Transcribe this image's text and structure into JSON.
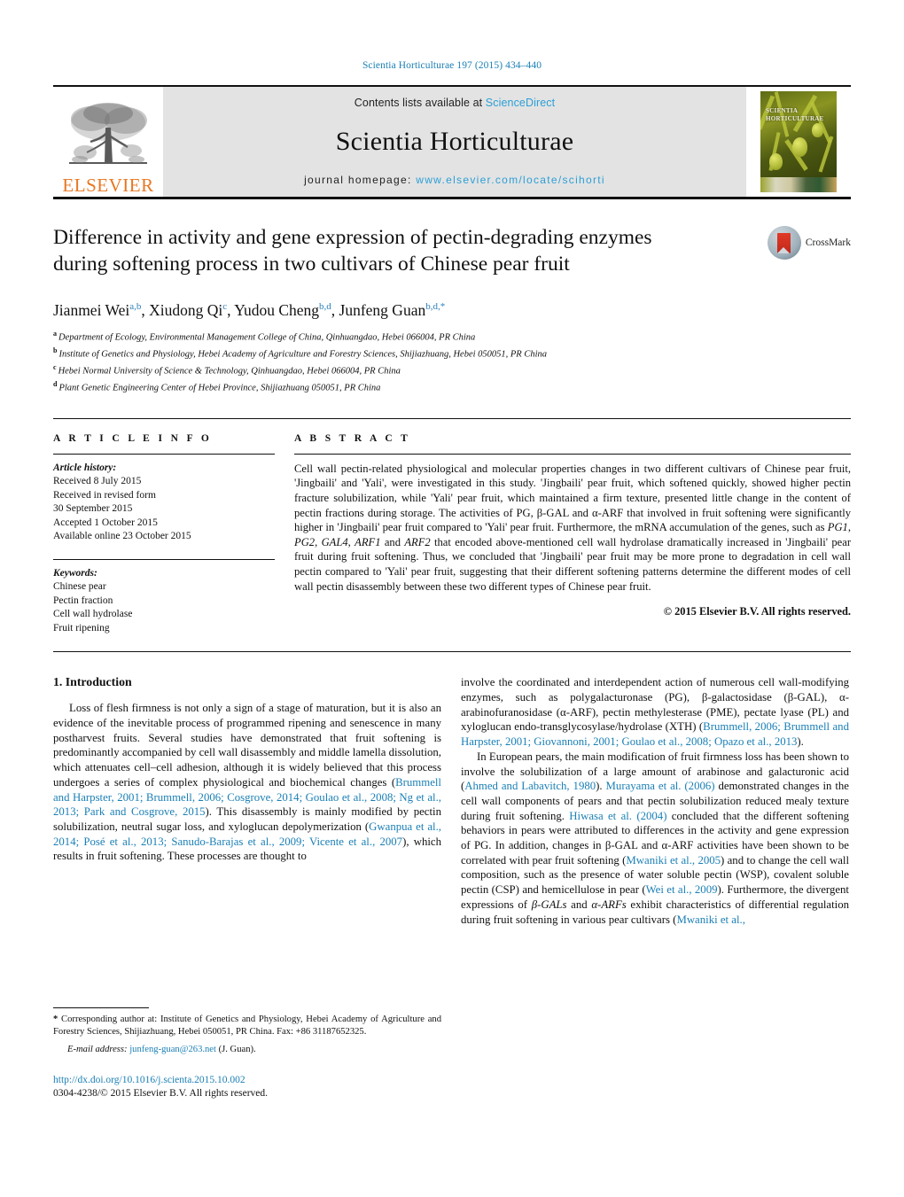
{
  "running_head": "Scientia Horticulturae 197 (2015) 434–440",
  "masthead": {
    "contents_prefix": "Contents lists available at ",
    "sciencedirect": "ScienceDirect",
    "journal_title": "Scientia Horticulturae",
    "homepage_prefix": "journal homepage: ",
    "homepage_url": "www.elsevier.com/locate/scihorti",
    "publisher": "ELSEVIER",
    "cover_title_line1": "SCIENTIA",
    "cover_title_line2": "HORTICULTURAE",
    "link_color": "#2c9fd6",
    "publisher_color": "#E87722"
  },
  "article": {
    "title": "Difference in activity and gene expression of pectin-degrading enzymes during softening process in two cultivars of Chinese pear fruit",
    "crossmark_label": "CrossMark",
    "authors_html": "Jianmei Wei<sup>a,b</sup>, Xiudong Qi<sup>c</sup>, Yudou Cheng<sup>b,d</sup>, Junfeng Guan<sup>b,d,</sup><sup>*</sup>",
    "affiliations": [
      {
        "marker": "a",
        "text": "Department of Ecology, Environmental Management College of China, Qinhuangdao, Hebei 066004, PR China"
      },
      {
        "marker": "b",
        "text": "Institute of Genetics and Physiology, Hebei Academy of Agriculture and Forestry Sciences, Shijiazhuang, Hebei 050051, PR China"
      },
      {
        "marker": "c",
        "text": "Hebei Normal University of Science & Technology, Qinhuangdao, Hebei 066004, PR China"
      },
      {
        "marker": "d",
        "text": "Plant Genetic Engineering Center of Hebei Province, Shijiazhuang 050051, PR China"
      }
    ]
  },
  "article_info": {
    "heading": "A R T I C L E   I N F O",
    "history_label": "Article history:",
    "history_lines": [
      "Received 8 July 2015",
      "Received in revised form",
      "30 September 2015",
      "Accepted 1 October 2015",
      "Available online 23 October 2015"
    ],
    "keywords_label": "Keywords:",
    "keywords": [
      "Chinese pear",
      "Pectin fraction",
      "Cell wall hydrolase",
      "Fruit ripening"
    ]
  },
  "abstract": {
    "heading": "A B S T R A C T",
    "body_html": "Cell wall pectin-related physiological and molecular properties changes in two different cultivars of Chinese pear fruit, 'Jingbaili' and 'Yali', were investigated in this study. 'Jingbaili' pear fruit, which softened quickly, showed higher pectin fracture solubilization, while 'Yali' pear fruit, which maintained a firm texture, presented little change in the content of pectin fractions during storage. The activities of PG, β-GAL and α-ARF that involved in fruit softening were significantly higher in 'Jingbaili' pear fruit compared to 'Yali' pear fruit. Furthermore, the mRNA accumulation of the genes, such as <i>PG1</i>, <i>PG2</i>, <i>GAL4</i>, <i>ARF1</i> and <i>ARF2</i> that encoded above-mentioned cell wall hydrolase dramatically increased in 'Jingbaili' pear fruit during fruit softening. Thus, we concluded that 'Jingbaili' pear fruit may be more prone to degradation in cell wall pectin compared to 'Yali' pear fruit, suggesting that their different softening patterns determine the different modes of cell wall pectin disassembly between these two different types of Chinese pear fruit.",
    "copyright": "© 2015 Elsevier B.V. All rights reserved."
  },
  "introduction": {
    "heading": "1.  Introduction",
    "left_paragraph_html": "Loss of flesh firmness is not only a sign of a stage of maturation, but it is also an evidence of the inevitable process of programmed ripening and senescence in many postharvest fruits. Several studies have demonstrated that fruit softening is predominantly accompanied by cell wall disassembly and middle lamella dissolution, which attenuates cell–cell adhesion, although it is widely believed that this process undergoes a series of complex physiological and biochemical changes (<span class=\"cite\">Brummell and Harpster, 2001; Brummell, 2006; Cosgrove, 2014; Goulao et al., 2008; Ng et al., 2013; Park and Cosgrove, 2015</span>). This disassembly is mainly modified by pectin solubilization, neutral sugar loss, and xyloglucan depolymerization (<span class=\"cite\">Gwanpua et al., 2014; Posé et al., 2013; Sanudo-Barajas et al., 2009; Vicente et al., 2007</span>), which results in fruit softening. These processes are thought to",
    "right_paragraph_1_html": "involve the coordinated and interdependent action of numerous cell wall-modifying enzymes, such as polygalacturonase (PG), β-galactosidase (β-GAL), α-arabinofuranosidase (α-ARF), pectin methylesterase (PME), pectate lyase (PL) and xyloglucan endo-transglycosylase/hydrolase (XTH) (<span class=\"cite\">Brummell, 2006; Brummell and Harpster, 2001; Giovannoni, 2001; Goulao et al., 2008; Opazo et al., 2013</span>).",
    "right_paragraph_2_html": "In European pears, the main modification of fruit firmness loss has been shown to involve the solubilization of a large amount of arabinose and galacturonic acid (<span class=\"cite\">Ahmed and Labavitch, 1980</span>). <span class=\"cite\">Murayama et al. (2006)</span> demonstrated changes in the cell wall components of pears and that pectin solubilization reduced mealy texture during fruit softening. <span class=\"cite\">Hiwasa et al. (2004)</span> concluded that the different softening behaviors in pears were attributed to differences in the activity and gene expression of PG. In addition, changes in β-GAL and α-ARF activities have been shown to be correlated with pear fruit softening (<span class=\"cite\">Mwaniki et al., 2005</span>) and to change the cell wall composition, such as the presence of water soluble pectin (WSP), covalent soluble pectin (CSP) and hemicellulose in pear (<span class=\"cite\">Wei et al., 2009</span>). Furthermore, the divergent expressions of <span class=\"ital\">β-GALs</span> and <span class=\"ital\">α-ARFs</span> exhibit characteristics of differential regulation during fruit softening in various pear cultivars (<span class=\"cite\">Mwaniki et al.,</span>"
  },
  "footnotes": {
    "corresponding_html": "<span class=\"ast\">*</span> Corresponding author at: Institute of Genetics and Physiology, Hebei Academy of Agriculture and Forestry Sciences, Shijiazhuang, Hebei 050051, PR China. Fax: +86 31187652325.",
    "email_label": "E-mail address:",
    "email": "junfeng-guan@263.net",
    "email_owner": "(J. Guan).",
    "doi": "http://dx.doi.org/10.1016/j.scienta.2015.10.002",
    "issn_line": "0304-4238/© 2015 Elsevier B.V. All rights reserved."
  }
}
